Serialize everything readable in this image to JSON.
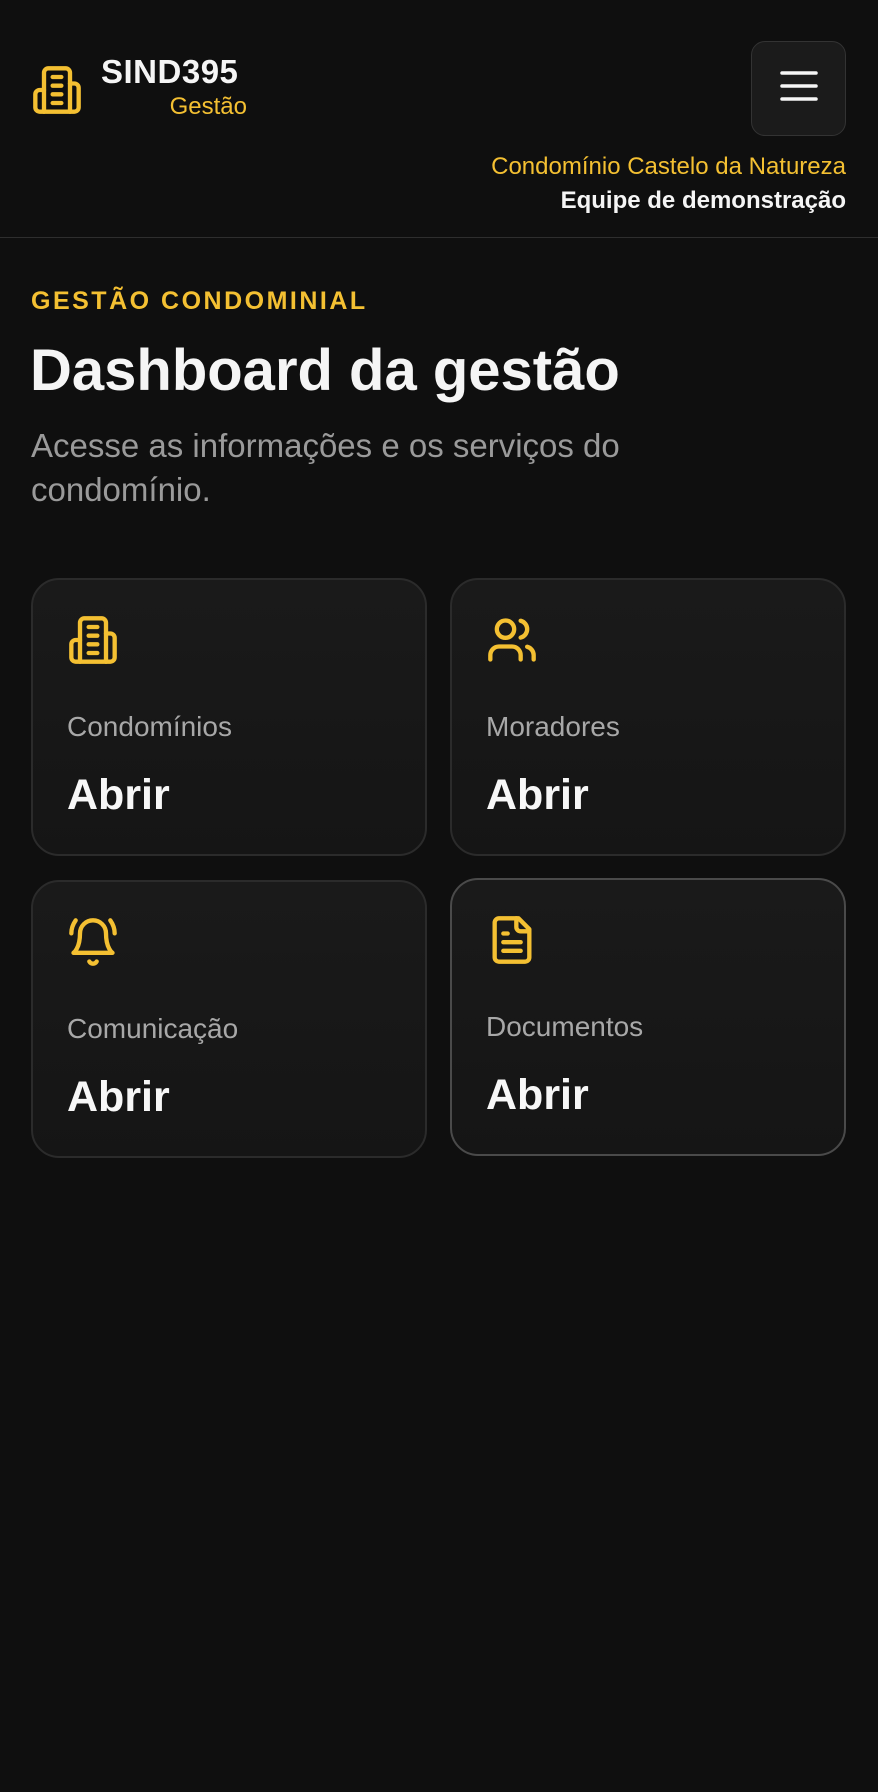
{
  "header": {
    "brand_title": "SIND395",
    "brand_subtitle": "Gestão",
    "brand_icon": "building-icon",
    "menu_icon": "hamburger-menu-icon",
    "condominium_name": "Condomínio Castelo da Natureza",
    "team_name": "Equipe de demonstração"
  },
  "intro": {
    "eyebrow": "GESTÃO CONDOMINIAL",
    "title": "Dashboard da gestão",
    "description": "Acesse as informações e os serviços do condomínio."
  },
  "cards": [
    {
      "label": "Condomínios",
      "action": "Abrir",
      "icon": "building-icon"
    },
    {
      "label": "Moradores",
      "action": "Abrir",
      "icon": "users-icon"
    },
    {
      "label": "Comunicação",
      "action": "Abrir",
      "icon": "bell-icon"
    },
    {
      "label": "Documentos",
      "action": "Abrir",
      "icon": "document-icon"
    }
  ],
  "colors": {
    "background": "#0f0f0f",
    "accent": "#f4c032",
    "card_background": "#181818",
    "text_primary": "#f5f5f5",
    "text_muted": "#9a9a9a"
  }
}
